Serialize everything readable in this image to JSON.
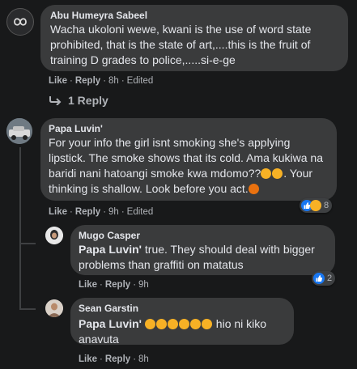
{
  "comments": [
    {
      "author": "Abu Humeyra Sabeel",
      "text": "Wacha ukoloni wewe, kwani is the use of word state prohibited, that is the state of art,....this is the fruit of training D grades to police,.....si-e-ge",
      "actions": {
        "like": "Like",
        "reply": "Reply",
        "time": "8h",
        "edited": "Edited"
      },
      "replies_link": "1 Reply"
    },
    {
      "author": "Papa Luvin'",
      "text": "For your info the girl isnt smoking she's applying lipstick. The smoke shows that its cold. Ama kukiwa na baridi nani hatoangi smoke kwa mdomo??",
      "text2": "Your thinking is shallow. Look before you act.",
      "actions": {
        "like": "Like",
        "reply": "Reply",
        "time": "9h",
        "edited": "Edited"
      },
      "reaction_count": "8"
    },
    {
      "author": "Mugo Casper",
      "mention": "Papa Luvin'",
      "text": " true. They should deal with bigger problems than graffiti on matatus",
      "actions": {
        "like": "Like",
        "reply": "Reply",
        "time": "9h"
      },
      "reaction_count": "2"
    },
    {
      "author": "Sean Garstin",
      "mention": "Papa Luvin'",
      "text": " hio ni kiko anavuta",
      "actions": {
        "like": "Like",
        "reply": "Reply",
        "time": "8h"
      }
    }
  ],
  "colors": {
    "background": "#18191a",
    "bubble": "#3a3b3c",
    "text": "#e4e6eb",
    "secondary": "#b0b3b8",
    "like_blue": "#1877f2",
    "emoji_yellow": "#f7b125"
  }
}
